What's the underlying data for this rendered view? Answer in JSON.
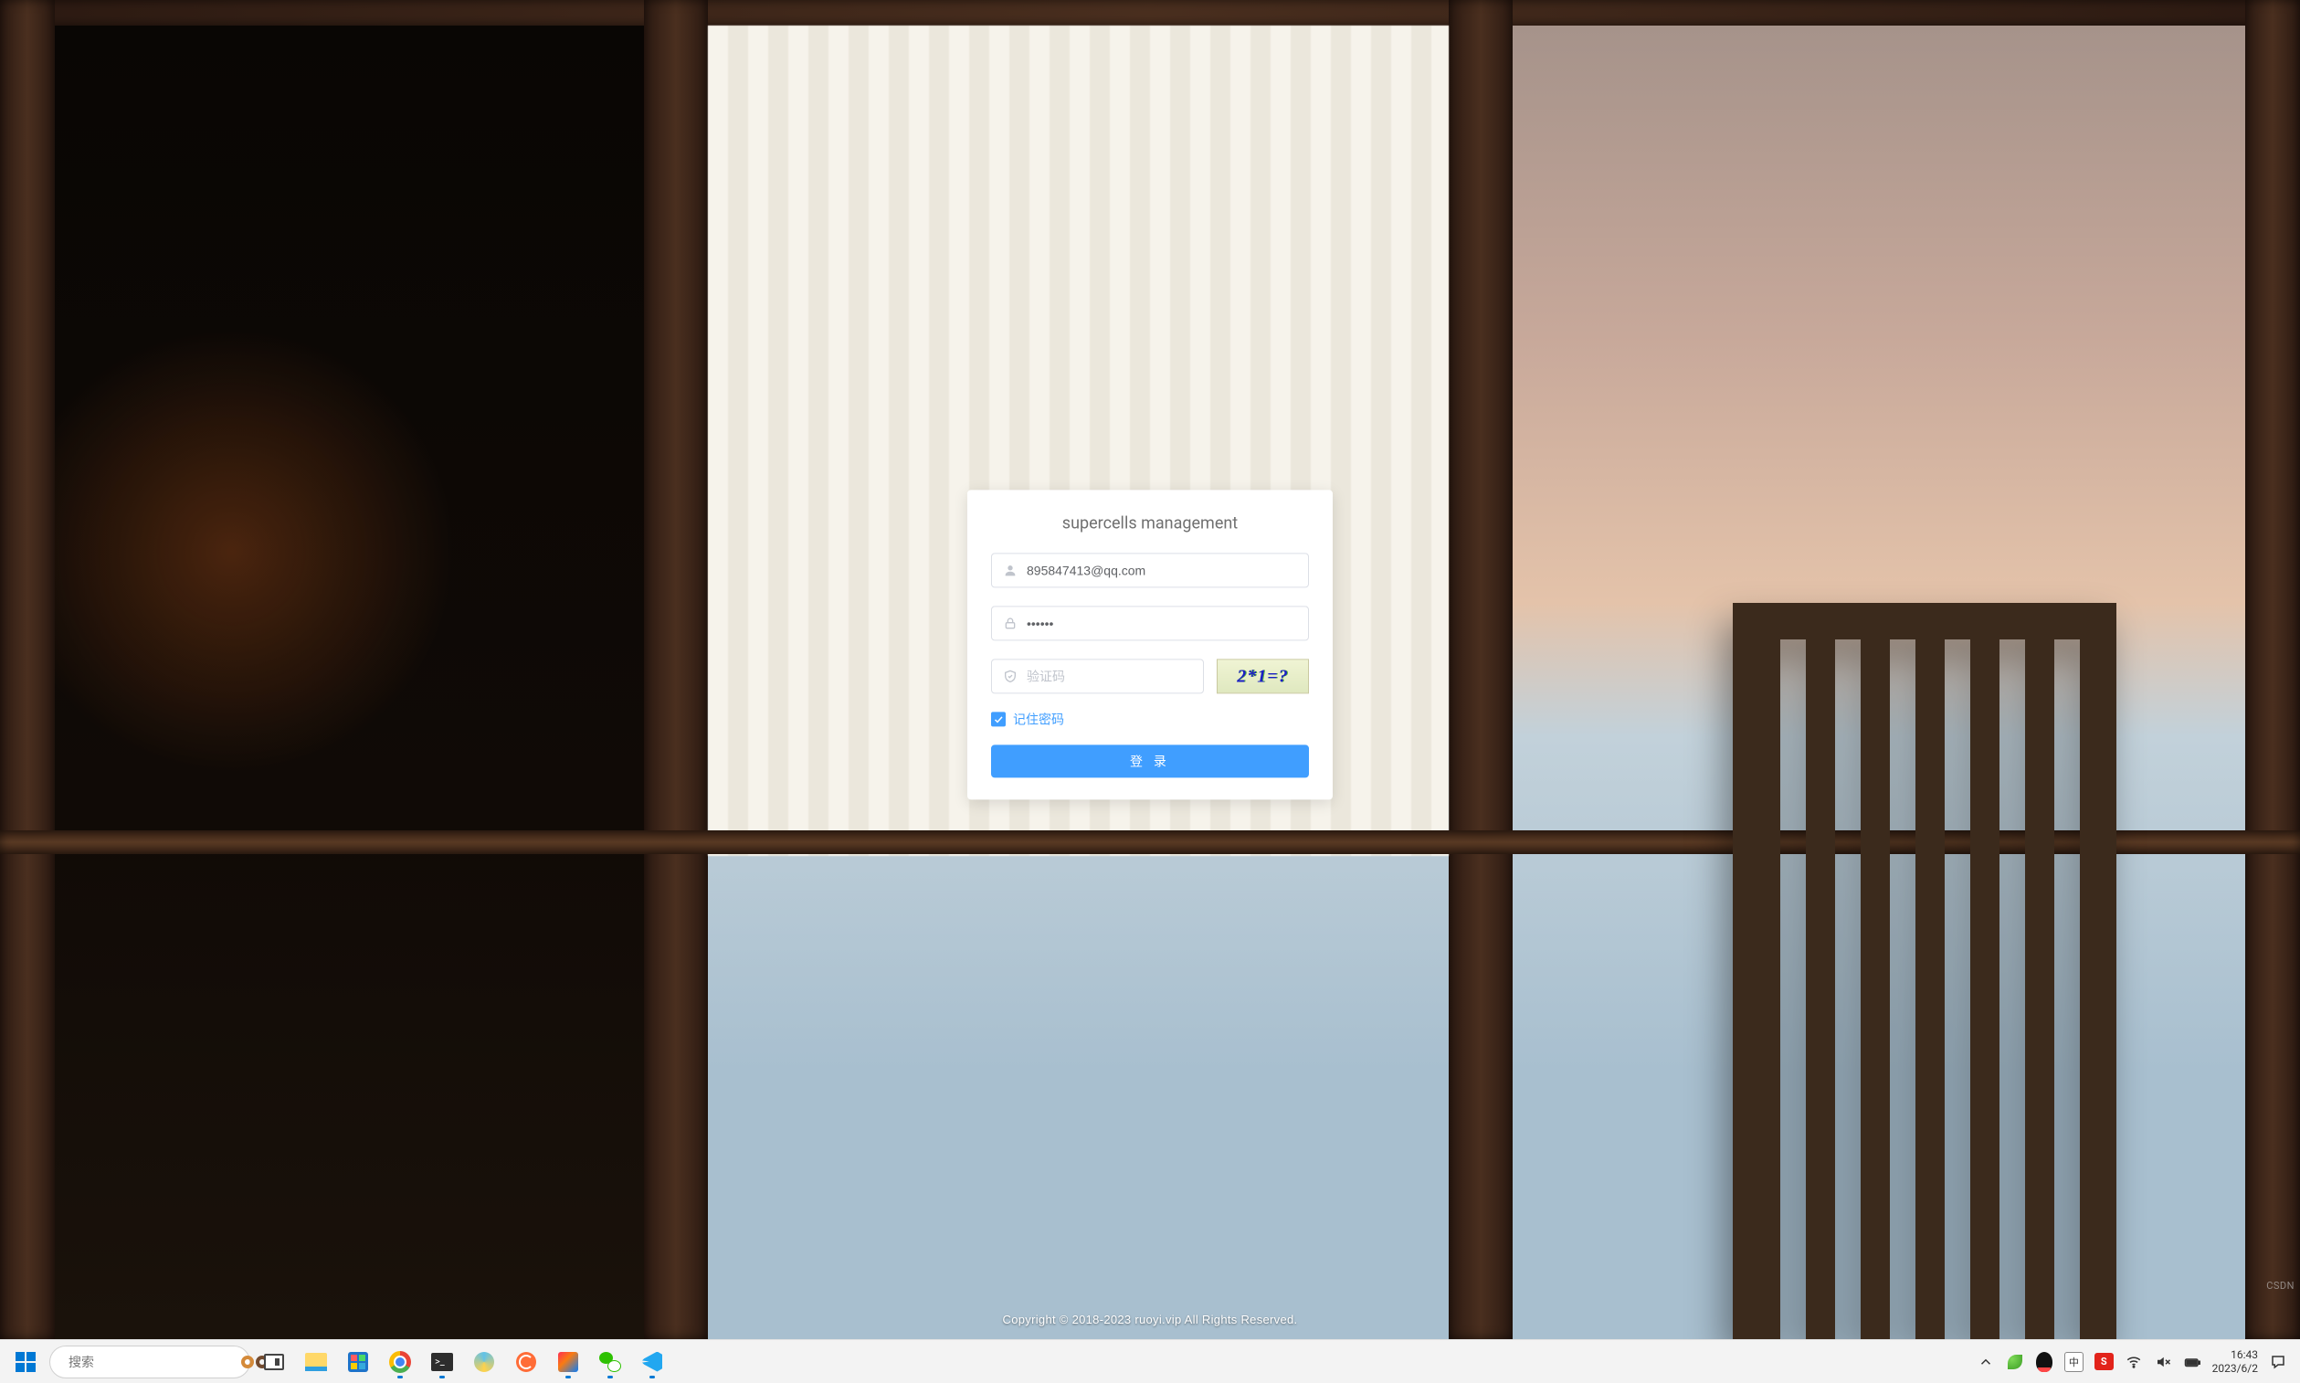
{
  "login": {
    "title": "supercells management",
    "username_value": "895847413@qq.com",
    "password_value": "••••••",
    "captcha_placeholder": "验证码",
    "captcha_image_text": "2*1=?",
    "remember_label": "记住密码",
    "remember_checked": true,
    "submit_label": "登 录"
  },
  "footer": {
    "copyright": "Copyright © 2018-2023 ruoyi.vip All Rights Reserved."
  },
  "taskbar": {
    "search_placeholder": "搜索",
    "ime_lang": "中",
    "ime_engine": "S",
    "clock_time": "16:43",
    "clock_date": "2023/6/2"
  },
  "watermark": "CSDN"
}
